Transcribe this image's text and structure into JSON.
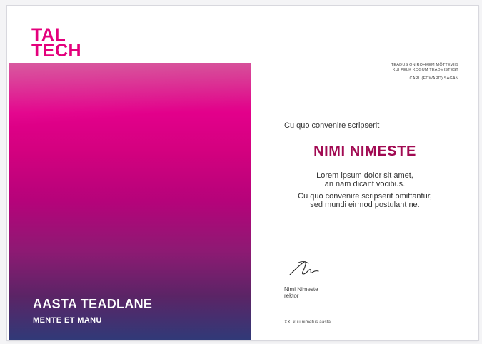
{
  "logo": {
    "line1": "TAL",
    "line2": "TECH"
  },
  "panel": {
    "title": "AASTA TEADLANE",
    "subtitle": "MENTE ET MANU"
  },
  "quote": {
    "line1": "TEADUS ON ROHKEM MÕTTEVIIS",
    "line2": "KUI PELK KOGUM TEADMISTEST",
    "author": "CARL (EDWARD) SAGAN"
  },
  "intro": "Cu quo convenire scripserit",
  "recipient_name": "NIMI NIMESTE",
  "body": {
    "line1": "Lorem ipsum dolor sit amet,",
    "line2": "an nam dicant vocibus.",
    "line3": "Cu quo convenire scripserit omittantur,",
    "line4": "sed mundi eirmod postulant ne."
  },
  "signatory": {
    "name": "Nimi Nimeste",
    "title": "rektor"
  },
  "date_text": "XX. kuu nimetus aasta",
  "colors": {
    "brand_magenta": "#e4007c",
    "name_color": "#a10a52",
    "panel_bottom": "#303a78"
  }
}
